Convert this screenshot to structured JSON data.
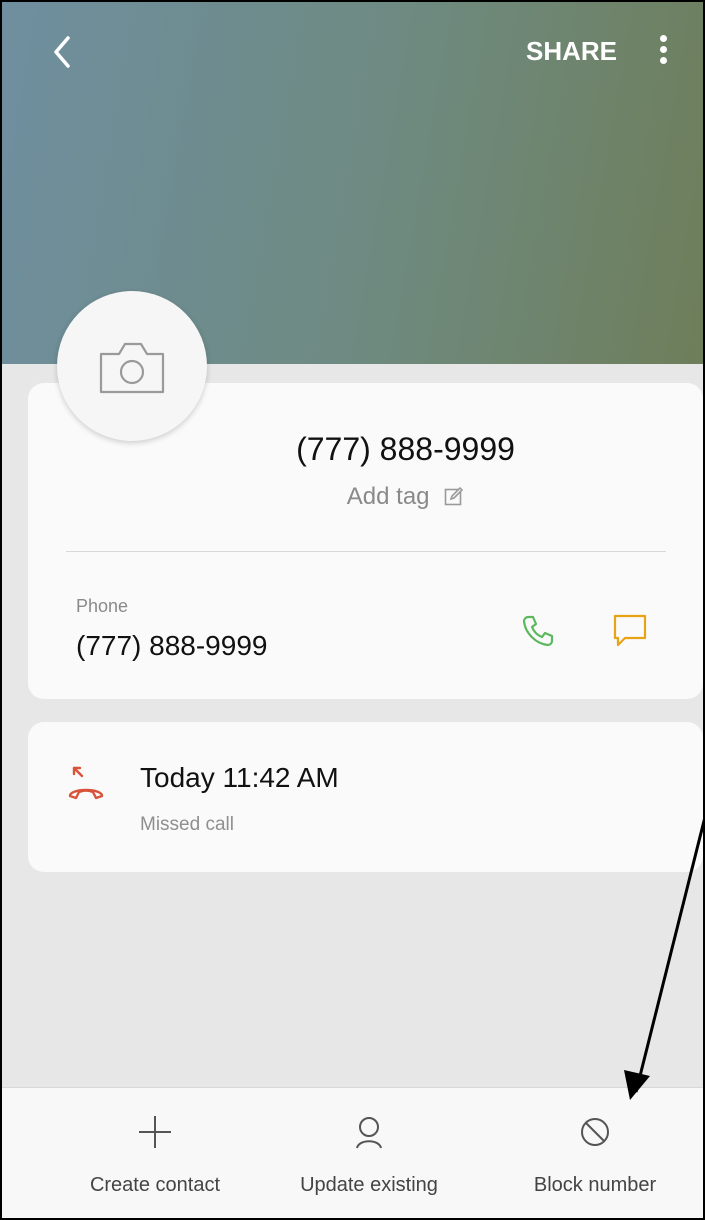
{
  "header": {
    "share_label": "SHARE",
    "icons": [
      "back-chevron-icon",
      "more-vertical-icon"
    ]
  },
  "contact": {
    "title": "(777) 888-9999",
    "add_tag_label": "Add tag",
    "phone_label": "Phone",
    "phone_number": "(777) 888-9999",
    "avatar_icon": "camera-icon"
  },
  "call_log": {
    "time": "Today 11:42 AM",
    "type": "Missed call",
    "icon": "missed-call-icon"
  },
  "bottom_bar": {
    "create_contact": "Create contact",
    "update_existing": "Update existing",
    "block_number": "Block number"
  },
  "colors": {
    "call_icon": "#5cb85c",
    "message_icon": "#e8a317",
    "missed_call": "#d9533b"
  }
}
